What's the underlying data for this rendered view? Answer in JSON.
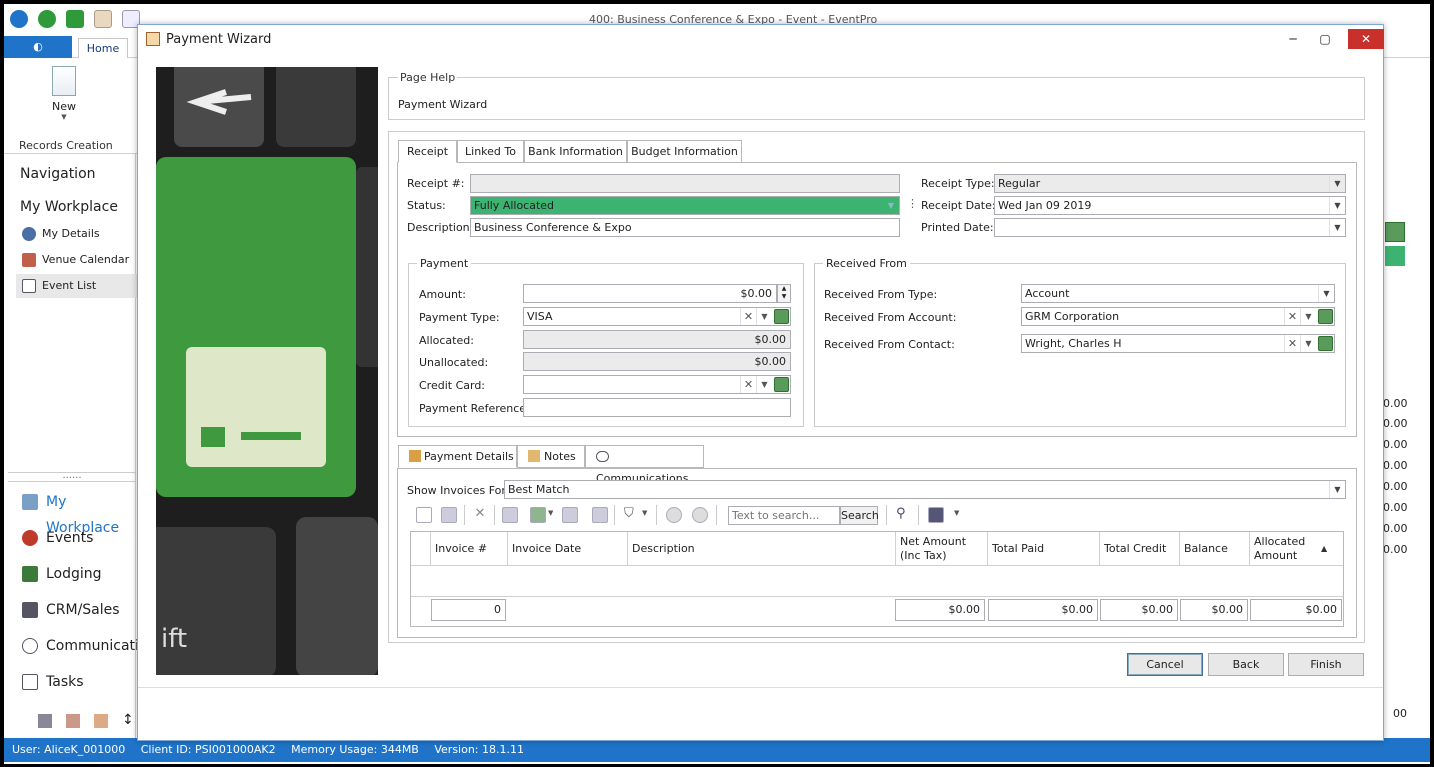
{
  "app": {
    "title": "400: Business Conference & Expo - Event - EventPro",
    "ribbon_tab_home": "Home",
    "ribbon_new": "New",
    "ribbon_group": "Records Creation"
  },
  "navigation": {
    "title": "Navigation",
    "workplace_title": "My Workplace",
    "items": [
      {
        "label": "My Details",
        "icon": "user-icon"
      },
      {
        "label": "Venue Calendar",
        "icon": "calendar-icon"
      },
      {
        "label": "Event List",
        "icon": "document-icon"
      }
    ],
    "sections": [
      {
        "label": "My Workplace",
        "icon": "home-icon"
      },
      {
        "label": "Events",
        "icon": "pin-icon"
      },
      {
        "label": "Lodging",
        "icon": "bed-icon"
      },
      {
        "label": "CRM/Sales",
        "icon": "sitemap-icon"
      },
      {
        "label": "Communication",
        "icon": "speech-bubble-icon"
      },
      {
        "label": "Tasks",
        "icon": "checklist-icon"
      }
    ]
  },
  "statusbar": {
    "user": "User: AliceK_001000",
    "client": "Client ID: PSI001000AK2",
    "memory": "Memory Usage: 344MB",
    "version": "Version: 18.1.11"
  },
  "background_values": [
    "0.00",
    "0.00",
    "0.00",
    "0.00",
    "0.00",
    "0.00",
    "0.00",
    "0.00"
  ],
  "background_bottom_value": "00",
  "dialog": {
    "title": "Payment Wizard",
    "page_help_label": "Page Help",
    "page_help_text": "Payment Wizard",
    "tabs": [
      "Receipt",
      "Linked To",
      "Bank Information",
      "Budget Information"
    ],
    "receipt": {
      "receipt_no_label": "Receipt #:",
      "receipt_no": "",
      "status_label": "Status:",
      "status": "Fully Allocated",
      "description_label": "Description:",
      "description": "Business Conference & Expo",
      "receipt_type_label": "Receipt Type:",
      "receipt_type": "Regular",
      "receipt_date_label": "Receipt Date:",
      "receipt_date": "Wed Jan 09 2019",
      "printed_date_label": "Printed Date:",
      "printed_date": ""
    },
    "payment": {
      "group_label": "Payment",
      "amount_label": "Amount:",
      "amount": "$0.00",
      "payment_type_label": "Payment Type:",
      "payment_type": "VISA",
      "allocated_label": "Allocated:",
      "allocated": "$0.00",
      "unallocated_label": "Unallocated:",
      "unallocated": "$0.00",
      "credit_card_label": "Credit Card:",
      "credit_card": "",
      "reference_label": "Payment Reference:",
      "reference": ""
    },
    "received_from": {
      "group_label": "Received From",
      "type_label": "Received From Type:",
      "type": "Account",
      "account_label": "Received From Account:",
      "account": "GRM Corporation",
      "contact_label": "Received From Contact:",
      "contact": "Wright, Charles H"
    },
    "detail_tabs": [
      "Payment Details",
      "Notes",
      "Communications"
    ],
    "show_invoices_label": "Show Invoices For:",
    "show_invoices": "Best Match",
    "search_placeholder": "Text to search...",
    "search_button": "Search",
    "grid": {
      "columns": [
        "Invoice #",
        "Invoice Date",
        "Description",
        "Net Amount (Inc Tax)",
        "Total Paid",
        "Total Credit",
        "Balance",
        "Allocated Amount"
      ],
      "totals": {
        "count": "0",
        "net_amount": "$0.00",
        "total_paid": "$0.00",
        "total_credit": "$0.00",
        "balance": "$0.00",
        "allocated": "$0.00"
      }
    },
    "buttons": {
      "cancel": "Cancel",
      "back": "Back",
      "finish": "Finish"
    },
    "colors": {
      "status_green": "#3cb371",
      "accent_blue": "#1f74c9",
      "keyboard_green": "#3f9a3f"
    }
  }
}
